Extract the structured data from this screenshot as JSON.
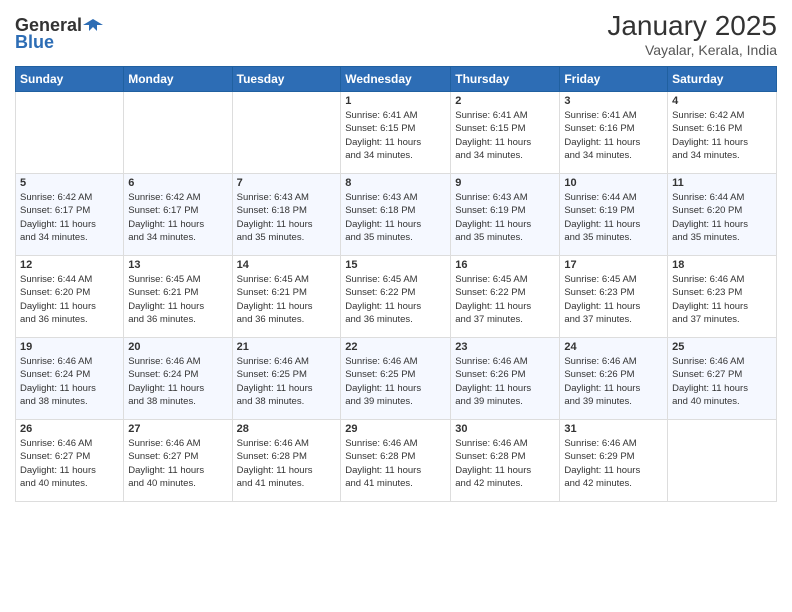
{
  "header": {
    "logo_general": "General",
    "logo_blue": "Blue",
    "title": "January 2025",
    "subtitle": "Vayalar, Kerala, India"
  },
  "weekdays": [
    "Sunday",
    "Monday",
    "Tuesday",
    "Wednesday",
    "Thursday",
    "Friday",
    "Saturday"
  ],
  "weeks": [
    [
      {
        "day": "",
        "info": ""
      },
      {
        "day": "",
        "info": ""
      },
      {
        "day": "",
        "info": ""
      },
      {
        "day": "1",
        "info": "Sunrise: 6:41 AM\nSunset: 6:15 PM\nDaylight: 11 hours\nand 34 minutes."
      },
      {
        "day": "2",
        "info": "Sunrise: 6:41 AM\nSunset: 6:15 PM\nDaylight: 11 hours\nand 34 minutes."
      },
      {
        "day": "3",
        "info": "Sunrise: 6:41 AM\nSunset: 6:16 PM\nDaylight: 11 hours\nand 34 minutes."
      },
      {
        "day": "4",
        "info": "Sunrise: 6:42 AM\nSunset: 6:16 PM\nDaylight: 11 hours\nand 34 minutes."
      }
    ],
    [
      {
        "day": "5",
        "info": "Sunrise: 6:42 AM\nSunset: 6:17 PM\nDaylight: 11 hours\nand 34 minutes."
      },
      {
        "day": "6",
        "info": "Sunrise: 6:42 AM\nSunset: 6:17 PM\nDaylight: 11 hours\nand 34 minutes."
      },
      {
        "day": "7",
        "info": "Sunrise: 6:43 AM\nSunset: 6:18 PM\nDaylight: 11 hours\nand 35 minutes."
      },
      {
        "day": "8",
        "info": "Sunrise: 6:43 AM\nSunset: 6:18 PM\nDaylight: 11 hours\nand 35 minutes."
      },
      {
        "day": "9",
        "info": "Sunrise: 6:43 AM\nSunset: 6:19 PM\nDaylight: 11 hours\nand 35 minutes."
      },
      {
        "day": "10",
        "info": "Sunrise: 6:44 AM\nSunset: 6:19 PM\nDaylight: 11 hours\nand 35 minutes."
      },
      {
        "day": "11",
        "info": "Sunrise: 6:44 AM\nSunset: 6:20 PM\nDaylight: 11 hours\nand 35 minutes."
      }
    ],
    [
      {
        "day": "12",
        "info": "Sunrise: 6:44 AM\nSunset: 6:20 PM\nDaylight: 11 hours\nand 36 minutes."
      },
      {
        "day": "13",
        "info": "Sunrise: 6:45 AM\nSunset: 6:21 PM\nDaylight: 11 hours\nand 36 minutes."
      },
      {
        "day": "14",
        "info": "Sunrise: 6:45 AM\nSunset: 6:21 PM\nDaylight: 11 hours\nand 36 minutes."
      },
      {
        "day": "15",
        "info": "Sunrise: 6:45 AM\nSunset: 6:22 PM\nDaylight: 11 hours\nand 36 minutes."
      },
      {
        "day": "16",
        "info": "Sunrise: 6:45 AM\nSunset: 6:22 PM\nDaylight: 11 hours\nand 37 minutes."
      },
      {
        "day": "17",
        "info": "Sunrise: 6:45 AM\nSunset: 6:23 PM\nDaylight: 11 hours\nand 37 minutes."
      },
      {
        "day": "18",
        "info": "Sunrise: 6:46 AM\nSunset: 6:23 PM\nDaylight: 11 hours\nand 37 minutes."
      }
    ],
    [
      {
        "day": "19",
        "info": "Sunrise: 6:46 AM\nSunset: 6:24 PM\nDaylight: 11 hours\nand 38 minutes."
      },
      {
        "day": "20",
        "info": "Sunrise: 6:46 AM\nSunset: 6:24 PM\nDaylight: 11 hours\nand 38 minutes."
      },
      {
        "day": "21",
        "info": "Sunrise: 6:46 AM\nSunset: 6:25 PM\nDaylight: 11 hours\nand 38 minutes."
      },
      {
        "day": "22",
        "info": "Sunrise: 6:46 AM\nSunset: 6:25 PM\nDaylight: 11 hours\nand 39 minutes."
      },
      {
        "day": "23",
        "info": "Sunrise: 6:46 AM\nSunset: 6:26 PM\nDaylight: 11 hours\nand 39 minutes."
      },
      {
        "day": "24",
        "info": "Sunrise: 6:46 AM\nSunset: 6:26 PM\nDaylight: 11 hours\nand 39 minutes."
      },
      {
        "day": "25",
        "info": "Sunrise: 6:46 AM\nSunset: 6:27 PM\nDaylight: 11 hours\nand 40 minutes."
      }
    ],
    [
      {
        "day": "26",
        "info": "Sunrise: 6:46 AM\nSunset: 6:27 PM\nDaylight: 11 hours\nand 40 minutes."
      },
      {
        "day": "27",
        "info": "Sunrise: 6:46 AM\nSunset: 6:27 PM\nDaylight: 11 hours\nand 40 minutes."
      },
      {
        "day": "28",
        "info": "Sunrise: 6:46 AM\nSunset: 6:28 PM\nDaylight: 11 hours\nand 41 minutes."
      },
      {
        "day": "29",
        "info": "Sunrise: 6:46 AM\nSunset: 6:28 PM\nDaylight: 11 hours\nand 41 minutes."
      },
      {
        "day": "30",
        "info": "Sunrise: 6:46 AM\nSunset: 6:28 PM\nDaylight: 11 hours\nand 42 minutes."
      },
      {
        "day": "31",
        "info": "Sunrise: 6:46 AM\nSunset: 6:29 PM\nDaylight: 11 hours\nand 42 minutes."
      },
      {
        "day": "",
        "info": ""
      }
    ]
  ]
}
